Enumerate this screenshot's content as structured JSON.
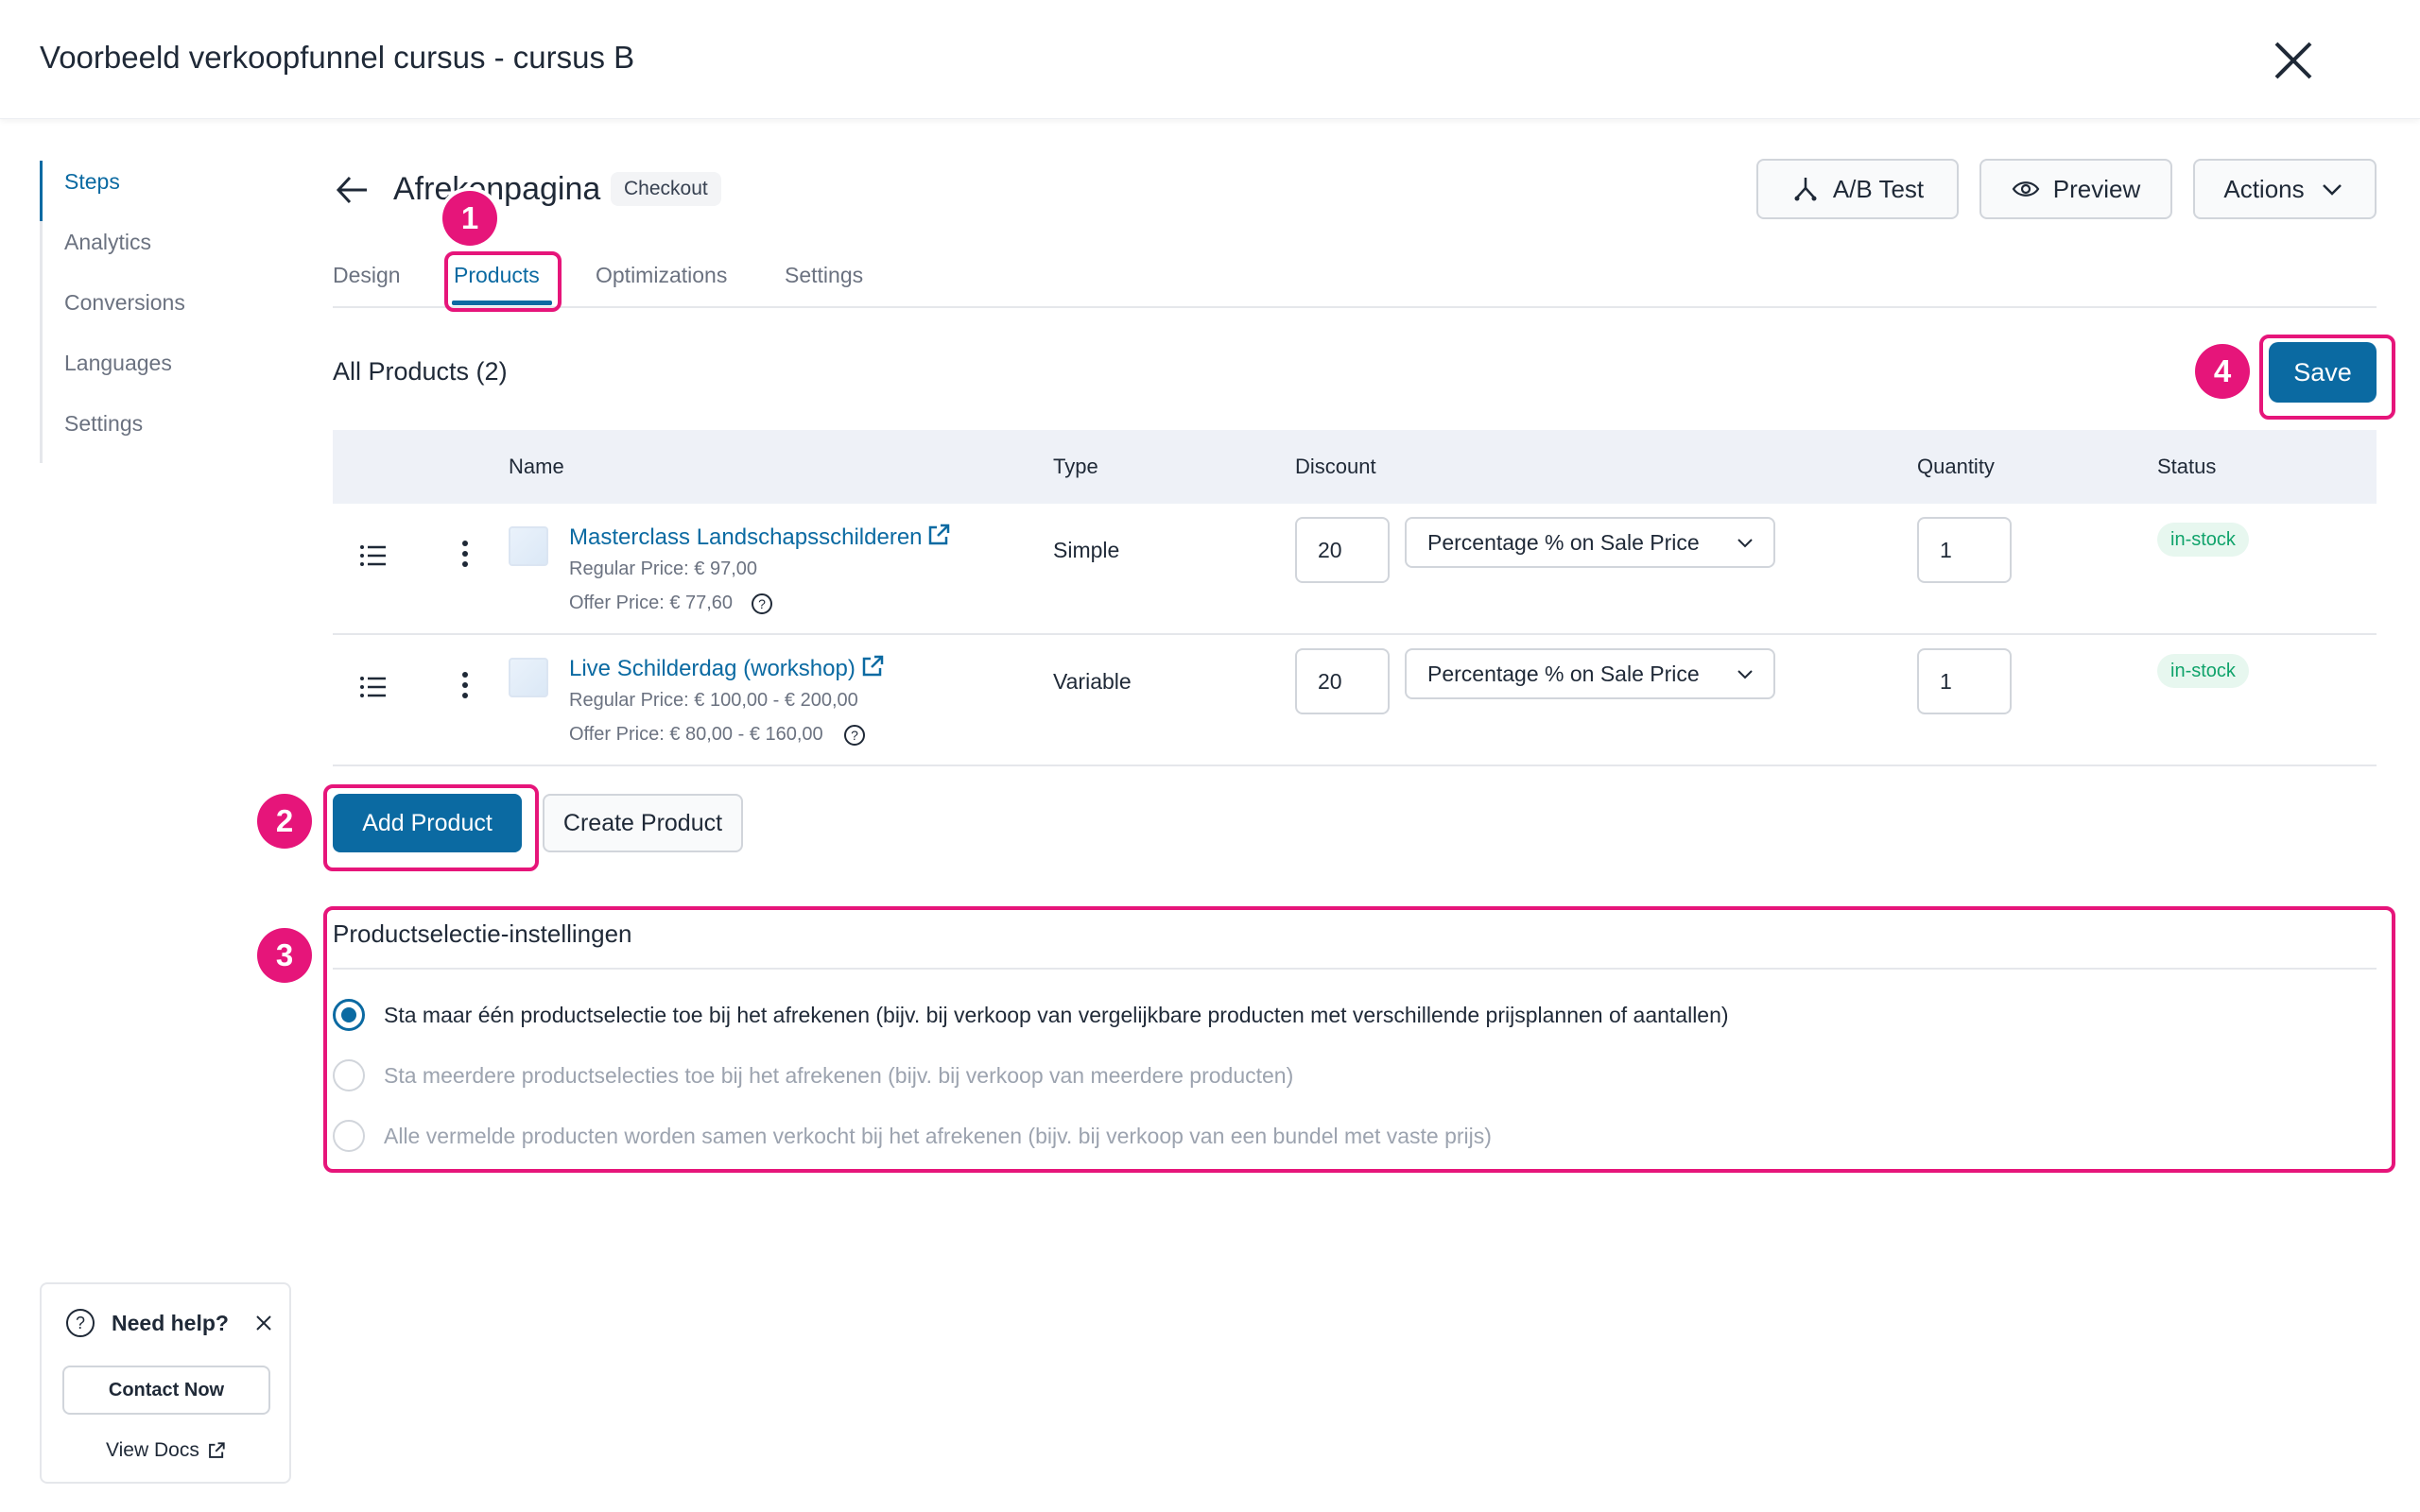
{
  "window": {
    "title": "Voorbeeld verkoopfunnel cursus - cursus B"
  },
  "sidebar": {
    "items": [
      {
        "label": "Steps",
        "active": true
      },
      {
        "label": "Analytics"
      },
      {
        "label": "Conversions"
      },
      {
        "label": "Languages"
      },
      {
        "label": "Settings"
      }
    ]
  },
  "step": {
    "title": "Afrekenpagina",
    "badge": "Checkout"
  },
  "header_actions": {
    "ab_test": "A/B Test",
    "preview": "Preview",
    "actions": "Actions"
  },
  "tabs": [
    {
      "label": "Design"
    },
    {
      "label": "Products",
      "active": true
    },
    {
      "label": "Optimizations"
    },
    {
      "label": "Settings"
    }
  ],
  "products": {
    "heading": "All Products (2)",
    "save": "Save",
    "columns": {
      "name": "Name",
      "type": "Type",
      "discount": "Discount",
      "quantity": "Quantity",
      "status": "Status"
    },
    "rows": [
      {
        "name": "Masterclass Landschapsschilderen",
        "regular": "Regular Price: € 97,00",
        "offer": "Offer Price: € 77,60",
        "type": "Simple",
        "discount_value": "20",
        "discount_type": "Percentage % on Sale Price",
        "quantity": "1",
        "status": "in-stock"
      },
      {
        "name": "Live Schilderdag (workshop)",
        "regular": "Regular Price: € 100,00 - € 200,00",
        "offer": "Offer Price: € 80,00 - € 160,00",
        "type": "Variable",
        "discount_value": "20",
        "discount_type": "Percentage % on Sale Price",
        "quantity": "1",
        "status": "in-stock"
      }
    ],
    "add_product": "Add Product",
    "create_product": "Create Product"
  },
  "selection": {
    "title": "Productselectie-instellingen",
    "options": [
      {
        "label": "Sta maar één productselectie toe bij het afrekenen (bijv. bij verkoop van vergelijkbare producten met verschillende prijsplannen of aantallen)",
        "selected": true
      },
      {
        "label": "Sta meerdere productselecties toe bij het afrekenen (bijv. bij verkoop van meerdere producten)",
        "selected": false
      },
      {
        "label": "Alle vermelde producten worden samen verkocht bij het afrekenen (bijv. bij verkoop van een bundel met vaste prijs)",
        "selected": false
      }
    ]
  },
  "annotations": {
    "n1": "1",
    "n2": "2",
    "n3": "3",
    "n4": "4",
    "color": "#e6157a"
  },
  "help": {
    "title": "Need help?",
    "contact": "Contact Now",
    "docs": "View Docs"
  },
  "colors": {
    "primary": "#0b6aa2",
    "status_bg": "#e7f7ef",
    "status_text": "#10a36b"
  }
}
